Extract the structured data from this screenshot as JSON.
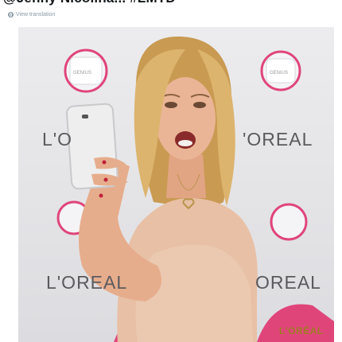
{
  "tweet": {
    "text": "@Jenny Nicolina... #LMTD",
    "translate_label": "View translation",
    "translate_icon": "globe-icon"
  },
  "photo": {
    "brand_wall_text": "L'ORÉAL",
    "brand_wall_fragments": [
      "L'O",
      "'OREAL",
      "L'OREAL",
      "OREAL"
    ],
    "brand_gold_text": "L'ORÉAL",
    "badge_text": "GENIUS"
  },
  "colors": {
    "wall": "#e8e8ea",
    "brand_gray": "#5a5a5e",
    "brand_gold": "#a07b25",
    "pink_accent": "#e0457a",
    "tank_top": "#e9c7ad",
    "hair": "#d8b46f",
    "skin": "#e6ad8c"
  }
}
